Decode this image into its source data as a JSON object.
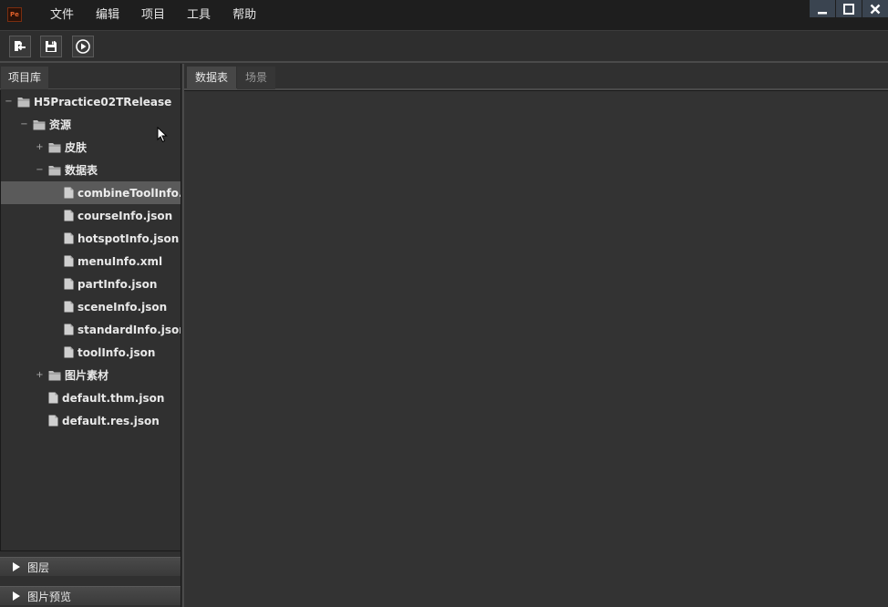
{
  "app": {
    "logo_text": "Pe",
    "menu": [
      "文件",
      "编辑",
      "项目",
      "工具",
      "帮助"
    ]
  },
  "toolbar": {
    "buttons": [
      "import-icon",
      "save-icon",
      "play-icon"
    ]
  },
  "left_panel": {
    "tab": "项目库",
    "tree": [
      {
        "label": "H5Practice02TRelease",
        "toggle": "−",
        "type": "folder",
        "depth": 0
      },
      {
        "label": "资源",
        "toggle": "−",
        "type": "folder",
        "depth": 1
      },
      {
        "label": "皮肤",
        "toggle": "+",
        "type": "folder",
        "depth": 2
      },
      {
        "label": "数据表",
        "toggle": "−",
        "type": "folder",
        "depth": 2
      },
      {
        "label": "combineToolInfo.json",
        "toggle": "",
        "type": "file",
        "depth": 3,
        "selected": true
      },
      {
        "label": "courseInfo.json",
        "toggle": "",
        "type": "file",
        "depth": 3
      },
      {
        "label": "hotspotInfo.json",
        "toggle": "",
        "type": "file",
        "depth": 3
      },
      {
        "label": "menuInfo.xml",
        "toggle": "",
        "type": "file",
        "depth": 3
      },
      {
        "label": "partInfo.json",
        "toggle": "",
        "type": "file",
        "depth": 3
      },
      {
        "label": "sceneInfo.json",
        "toggle": "",
        "type": "file",
        "depth": 3
      },
      {
        "label": "standardInfo.json",
        "toggle": "",
        "type": "file",
        "depth": 3
      },
      {
        "label": "toolInfo.json",
        "toggle": "",
        "type": "file",
        "depth": 3
      },
      {
        "label": "图片素材",
        "toggle": "+",
        "type": "folder",
        "depth": 2
      },
      {
        "label": "default.thm.json",
        "toggle": "",
        "type": "file",
        "depth": 2
      },
      {
        "label": "default.res.json",
        "toggle": "",
        "type": "file",
        "depth": 2
      }
    ],
    "panels": [
      "图层",
      "图片预览"
    ]
  },
  "content": {
    "tabs": [
      {
        "label": "数据表",
        "active": true
      },
      {
        "label": "场景",
        "active": false
      }
    ]
  },
  "colors": {
    "background": "#303030",
    "selected_row": "#5a5a5a",
    "window_button": "#3a4450"
  }
}
